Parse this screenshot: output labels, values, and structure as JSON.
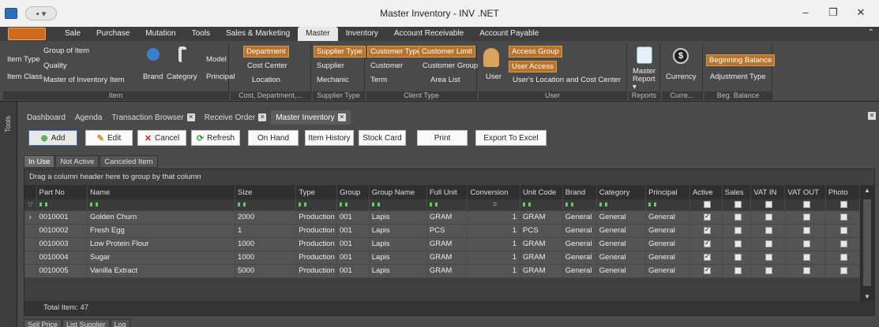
{
  "window": {
    "title": "Master Inventory - INV .NET",
    "minimize": "–",
    "restore": "❐",
    "close": "✕",
    "qat": "▪ ▾"
  },
  "ribbon": {
    "tabs": [
      "Sale",
      "Purchase",
      "Mutation",
      "Tools",
      "Sales & Marketing",
      "Master",
      "Inventory",
      "Account Receivable",
      "Account Payable"
    ],
    "active_tab": "Master",
    "collapse": "⌃",
    "item_group": {
      "item_type": "Item Type",
      "item_class": "Item Class",
      "group_of_item": "Group of Item",
      "quality": "Quality",
      "master_of_inventory_item": "Master of Inventory Item",
      "brand": "Brand",
      "category": "Category",
      "model": "Model",
      "principal": "Principal",
      "name": "Item"
    },
    "cost_group": {
      "department": "Department",
      "cost_center": "Cost Center",
      "location": "Location",
      "name": "Cost, Department,..."
    },
    "supplier_group": {
      "supplier_type": "Supplier Type",
      "supplier": "Supplier",
      "mechanic": "Mechanic",
      "name": "Supplier Type"
    },
    "client_group": {
      "customer_type": "Customer Type",
      "customer_limit": "Customer Limit",
      "customer": "Customer",
      "customer_group": "Customer Group",
      "term": "Term",
      "area_list": "Area List",
      "name": "Client Type"
    },
    "user_group": {
      "user": "User",
      "access_group": "Access Group",
      "user_access": "User Access",
      "user_location": "User's Location and Cost Center",
      "name": "User"
    },
    "reports_group": {
      "master_report": "Master Report ▾",
      "name": "Reports"
    },
    "currency_group": {
      "currency": "Currency",
      "name": "Curre..."
    },
    "balance_group": {
      "beginning_balance": "Beginning Balance",
      "adjustment_type": "Adjustment Type",
      "name": "Beg. Balance"
    }
  },
  "side_tools": "Tools",
  "doc_tabs": [
    {
      "label": "Dashboard",
      "closable": false
    },
    {
      "label": "Agenda",
      "closable": false
    },
    {
      "label": "Transaction Browser",
      "closable": true
    },
    {
      "label": "Receive Order",
      "closable": true
    },
    {
      "label": "Master Inventory",
      "closable": true,
      "active": true
    }
  ],
  "toolbar": {
    "add": "Add",
    "edit": "Edit",
    "cancel": "Cancel",
    "refresh": "Refresh",
    "on_hand": "On Hand",
    "item_history": "Item History",
    "stock_card": "Stock Card",
    "print": "Print",
    "export": "Export To Excel"
  },
  "filter_tabs": [
    "In Use",
    "Not Active",
    "Canceled Item"
  ],
  "grid": {
    "group_hint": "Drag a column header here to group by that column",
    "columns": [
      "Part No",
      "Name",
      "Size",
      "Type",
      "Group",
      "Group Name",
      "Full Unit",
      "Conversion",
      "Unit Code",
      "Brand",
      "Category",
      "Principal",
      "Active",
      "Sales",
      "VAT IN",
      "VAT OUT",
      "Photo"
    ],
    "filter_conversion": "=",
    "rows": [
      [
        "0010001",
        "Golden Churn",
        "2000",
        "Production",
        "001",
        "Lapis",
        "GRAM",
        "1",
        "GRAM",
        "General",
        "General",
        "General",
        true,
        false,
        false,
        false,
        false
      ],
      [
        "0010002",
        "Fresh Egg",
        "1",
        "Production",
        "001",
        "Lapis",
        "PCS",
        "1",
        "PCS",
        "General",
        "General",
        "General",
        true,
        false,
        false,
        false,
        false
      ],
      [
        "0010003",
        "Low Protein Flour",
        "1000",
        "Production",
        "001",
        "Lapis",
        "GRAM",
        "1",
        "GRAM",
        "General",
        "General",
        "General",
        true,
        false,
        false,
        false,
        false
      ],
      [
        "0010004",
        "Sugar",
        "1000",
        "Production",
        "001",
        "Lapis",
        "GRAM",
        "1",
        "GRAM",
        "General",
        "General",
        "General",
        true,
        false,
        false,
        false,
        false
      ],
      [
        "0010005",
        "Vanilla Extract",
        "5000",
        "Production",
        "001",
        "Lapis",
        "GRAM",
        "1",
        "GRAM",
        "General",
        "General",
        "General",
        true,
        false,
        false,
        false,
        false
      ]
    ],
    "total": "Total Item: 47"
  },
  "bottom_tabs": [
    "Sell Price",
    "List Supplier",
    "Log"
  ]
}
